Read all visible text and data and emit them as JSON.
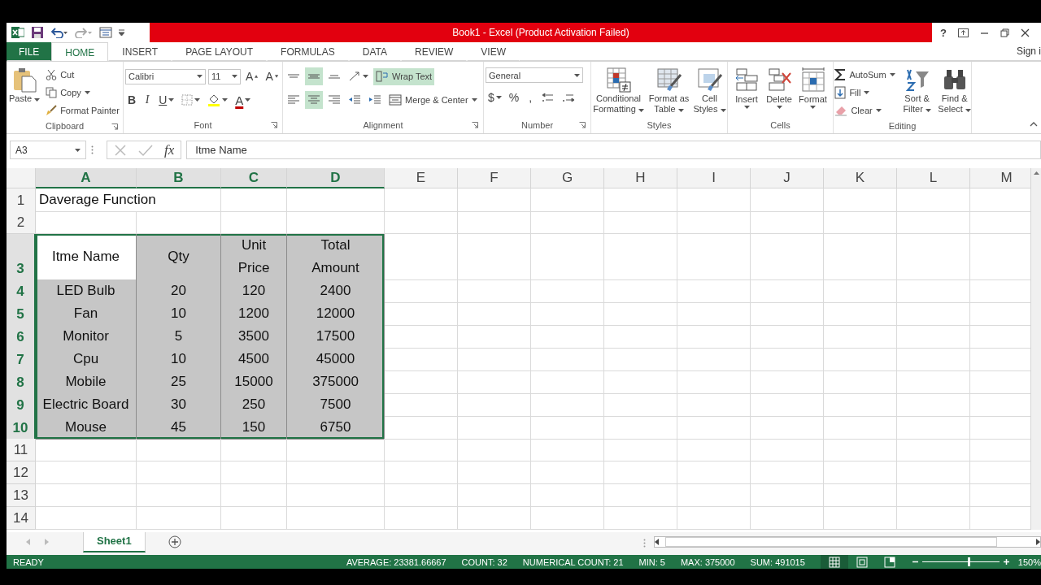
{
  "title_bar": {
    "title": "Book1 -  Excel (Product Activation Failed)",
    "help": "?"
  },
  "tabs": [
    {
      "label": "FILE",
      "kind": "file",
      "selected": false
    },
    {
      "label": "HOME",
      "kind": "tab",
      "selected": true
    },
    {
      "label": "INSERT",
      "kind": "tab",
      "selected": false
    },
    {
      "label": "PAGE LAYOUT",
      "kind": "tab",
      "selected": false
    },
    {
      "label": "FORMULAS",
      "kind": "tab",
      "selected": false
    },
    {
      "label": "DATA",
      "kind": "tab",
      "selected": false
    },
    {
      "label": "REVIEW",
      "kind": "tab",
      "selected": false
    },
    {
      "label": "VIEW",
      "kind": "tab",
      "selected": false
    }
  ],
  "sign_in": "Sign i",
  "ribbon": [
    {
      "label": "Clipboard",
      "launcher": true,
      "items": [
        {
          "kind": "large",
          "label": "Paste",
          "caret": true
        },
        {
          "kind": "small",
          "label": "Cut",
          "caret": false
        },
        {
          "kind": "small",
          "label": "Copy",
          "caret": true
        },
        {
          "kind": "small",
          "label": "Format Painter",
          "caret": false
        }
      ]
    },
    {
      "label": "Font",
      "launcher": true,
      "lines": [
        {
          "items": [
            {
              "kind": "combo",
              "value": "Calibri"
            },
            {
              "kind": "combo",
              "value": "11"
            },
            {
              "kind": "glyph",
              "text": "A",
              "caret": false
            },
            {
              "kind": "glyph",
              "text": "A",
              "caret": false
            }
          ]
        },
        {
          "items": [
            {
              "kind": "glyph",
              "text": "B",
              "caret": false
            },
            {
              "kind": "glyph",
              "text": "I",
              "caret": false
            },
            {
              "kind": "glyph",
              "text": "U",
              "caret": true
            },
            {
              "kind": "icon",
              "caret": true
            },
            {
              "kind": "icon",
              "caret": true
            },
            {
              "kind": "glyph",
              "text": "A",
              "caret": true
            }
          ]
        }
      ]
    },
    {
      "label": "Alignment",
      "launcher": true,
      "lines": [
        {
          "items": [
            {
              "kind": "icon",
              "caret": false,
              "selected": false
            },
            {
              "kind": "icon",
              "caret": false,
              "selected": true
            },
            {
              "kind": "icon",
              "caret": false,
              "selected": false
            },
            {
              "kind": "icon",
              "caret": true
            },
            {
              "kind": "wide",
              "label": "Wrap Text",
              "caret": false,
              "selected": true
            }
          ]
        },
        {
          "items": [
            {
              "kind": "icon",
              "caret": false,
              "selected": false
            },
            {
              "kind": "icon",
              "caret": false,
              "selected": true
            },
            {
              "kind": "icon",
              "caret": false,
              "selected": false
            },
            {
              "kind": "icon",
              "caret": false
            },
            {
              "kind": "icon",
              "caret": false
            },
            {
              "kind": "wide",
              "label": "Merge & Center",
              "caret": true,
              "selected": false
            }
          ]
        }
      ]
    },
    {
      "label": "Number",
      "launcher": true,
      "lines": [
        {
          "items": [
            {
              "kind": "combo",
              "value": "General"
            }
          ]
        },
        {
          "items": [
            {
              "kind": "glyph",
              "text": "$",
              "caret": true
            },
            {
              "kind": "glyph",
              "text": "%",
              "caret": false
            },
            {
              "kind": "glyph",
              "text": ",",
              "caret": false
            },
            {
              "kind": "icon",
              "caret": false
            },
            {
              "kind": "icon",
              "caret": false
            }
          ]
        }
      ]
    },
    {
      "label": "Styles",
      "launcher": false,
      "items": [
        {
          "kind": "large",
          "label": "Conditional Formatting",
          "caret": true
        },
        {
          "kind": "large",
          "label": "Format as Table",
          "caret": true
        },
        {
          "kind": "large",
          "label": "Cell Styles",
          "caret": true
        }
      ]
    },
    {
      "label": "Cells",
      "launcher": false,
      "items": [
        {
          "kind": "tall",
          "label": "Insert",
          "caret": true
        },
        {
          "kind": "tall",
          "label": "Delete",
          "caret": true
        },
        {
          "kind": "tall",
          "label": "Format",
          "caret": true
        }
      ]
    },
    {
      "label": "Editing",
      "launcher": false,
      "items": [
        {
          "kind": "small",
          "label": "AutoSum",
          "caret": true
        },
        {
          "kind": "small",
          "label": "Fill",
          "caret": true
        },
        {
          "kind": "small",
          "label": "Clear",
          "caret": true
        },
        {
          "kind": "large",
          "label": "Sort & Filter",
          "caret": true
        },
        {
          "kind": "large",
          "label": "Find & Select",
          "caret": true
        }
      ]
    }
  ],
  "formula_bar": {
    "name_box": "A3",
    "function_label": "fx",
    "formula": "Itme Name"
  },
  "grid": {
    "columns": [
      {
        "label": "A",
        "selected": true
      },
      {
        "label": "B",
        "selected": true
      },
      {
        "label": "C",
        "selected": true
      },
      {
        "label": "D",
        "selected": true
      },
      {
        "label": "E",
        "selected": false
      },
      {
        "label": "F",
        "selected": false
      },
      {
        "label": "G",
        "selected": false
      },
      {
        "label": "H",
        "selected": false
      },
      {
        "label": "I",
        "selected": false
      },
      {
        "label": "J",
        "selected": false
      },
      {
        "label": "K",
        "selected": false
      },
      {
        "label": "L",
        "selected": false
      },
      {
        "label": "M",
        "selected": false
      }
    ],
    "rows": [
      {
        "header": "1",
        "selected": false,
        "cells": [
          {
            "text": "Daverage Function"
          }
        ]
      },
      {
        "header": "2",
        "selected": false
      },
      {
        "header": "3",
        "selected": true,
        "cells": [
          {
            "text": "Itme Name",
            "active": true
          },
          {
            "text": "Qty",
            "active": false
          },
          {
            "text": "Unit Price",
            "active": false,
            "wrapped": true
          },
          {
            "text": "Total Amount",
            "active": false,
            "wrapped": true
          }
        ]
      },
      {
        "header": "4",
        "selected": true,
        "cells": [
          {
            "text": "LED Bulb",
            "active": false
          },
          {
            "text": "20",
            "active": false
          },
          {
            "text": "120",
            "active": false
          },
          {
            "text": "2400",
            "active": false
          }
        ]
      },
      {
        "header": "5",
        "selected": true,
        "cells": [
          {
            "text": "Fan",
            "active": false
          },
          {
            "text": "10",
            "active": false
          },
          {
            "text": "1200",
            "active": false
          },
          {
            "text": "12000",
            "active": false
          }
        ]
      },
      {
        "header": "6",
        "selected": true,
        "cells": [
          {
            "text": "Monitor",
            "active": false
          },
          {
            "text": "5",
            "active": false
          },
          {
            "text": "3500",
            "active": false
          },
          {
            "text": "17500",
            "active": false
          }
        ]
      },
      {
        "header": "7",
        "selected": true,
        "cells": [
          {
            "text": "Cpu",
            "active": false
          },
          {
            "text": "10",
            "active": false
          },
          {
            "text": "4500",
            "active": false
          },
          {
            "text": "45000",
            "active": false
          }
        ]
      },
      {
        "header": "8",
        "selected": true,
        "cells": [
          {
            "text": "Mobile",
            "active": false
          },
          {
            "text": "25",
            "active": false
          },
          {
            "text": "15000",
            "active": false
          },
          {
            "text": "375000",
            "active": false
          }
        ]
      },
      {
        "header": "9",
        "selected": true,
        "cells": [
          {
            "text": "Electric Board",
            "active": false
          },
          {
            "text": "30",
            "active": false
          },
          {
            "text": "250",
            "active": false
          },
          {
            "text": "7500",
            "active": false
          }
        ]
      },
      {
        "header": "10",
        "selected": true,
        "cells": [
          {
            "text": "Mouse",
            "active": false
          },
          {
            "text": "45",
            "active": false
          },
          {
            "text": "150",
            "active": false
          },
          {
            "text": "6750",
            "active": false
          }
        ]
      },
      {
        "header": "11",
        "selected": false
      },
      {
        "header": "12",
        "selected": false
      },
      {
        "header": "13",
        "selected": false
      },
      {
        "header": "14",
        "selected": false
      }
    ]
  },
  "sheets": [
    {
      "label": "Sheet1",
      "selected": true
    }
  ],
  "status_bar": {
    "mode": "READY",
    "stats": [
      "AVERAGE: 23381.66667",
      "COUNT: 32",
      "NUMERICAL COUNT: 21",
      "MIN: 5",
      "MAX: 375000",
      "SUM: 491015"
    ],
    "views": [
      {
        "kind": "normal",
        "selected": true
      },
      {
        "kind": "layout",
        "selected": false
      },
      {
        "kind": "break",
        "selected": false
      }
    ],
    "zoom": {
      "level": 0.6,
      "label": "150%"
    }
  }
}
